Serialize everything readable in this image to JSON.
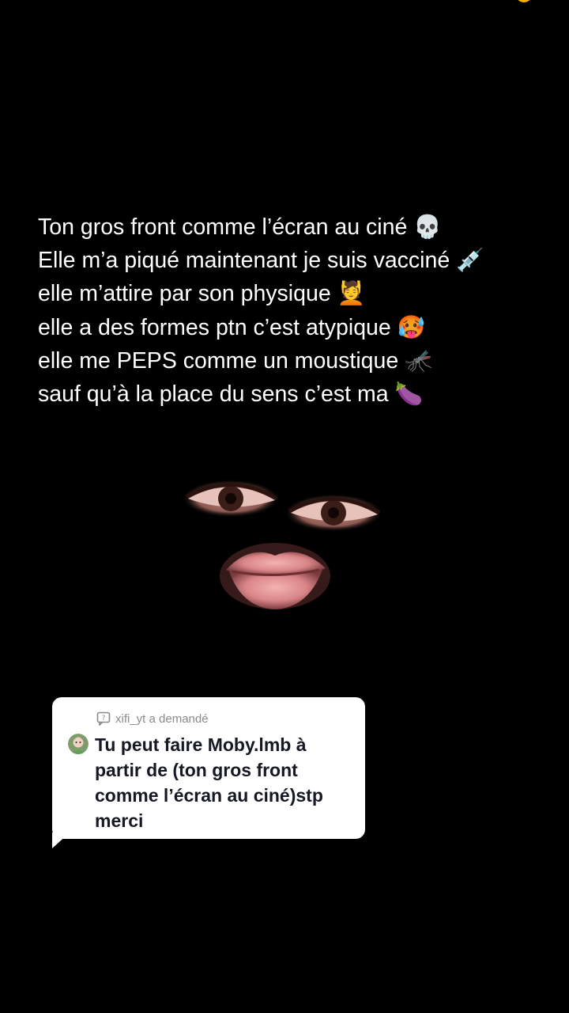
{
  "lyrics": [
    {
      "text": "Ton gros front comme l’écran au ciné",
      "emoji": "💀",
      "emoji_name": "skull-icon"
    },
    {
      "text": "Elle m’a piqué maintenant je suis vacciné",
      "emoji": "💉",
      "emoji_name": "syringe-icon"
    },
    {
      "text": "elle m’attire par son physique",
      "emoji": "💆",
      "emoji_name": "face-massage-icon"
    },
    {
      "text": "elle a des formes ptn c’est atypique",
      "emoji": "🥵",
      "emoji_name": "hot-face-icon"
    },
    {
      "text": "elle me PEPS comme un moustique",
      "emoji": "🦟",
      "emoji_name": "mosquito-icon"
    },
    {
      "text": "sauf qu’à la place du sens c’est ma",
      "emoji": "🍆",
      "emoji_name": "eggplant-icon"
    }
  ],
  "reply": {
    "header": "xifi_yt a demandé",
    "text": "Tu peut faire Moby.lmb à partir de (ton gros front comme l’écran au ciné)stp merci"
  },
  "colors": {
    "background": "#000000",
    "lyrics_text": "#ffffff",
    "card_background": "#ffffff",
    "card_text": "#161823",
    "card_meta": "#8a8a8a",
    "skin": "#b9827a",
    "lips": "#e79a9c"
  }
}
